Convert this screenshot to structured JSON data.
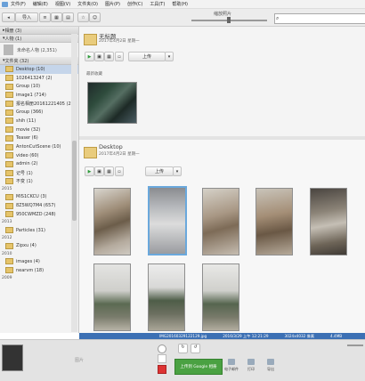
{
  "menu": [
    "文件(F)",
    "编辑(E)",
    "视图(V)",
    "文件夹(O)",
    "图片(P)",
    "创作(C)",
    "工具(T)",
    "帮助(H)"
  ],
  "toolbar": {
    "import_label": "导入",
    "zoom_label": "缩放照片"
  },
  "sidebar": {
    "sections": {
      "albums": "相册 (3)",
      "people": "人物 (1)",
      "folders": "文件夹 (32)"
    },
    "person_label": "未命名人物 (2,351)",
    "folders": [
      {
        "label": "Desktop (10)",
        "selected": true
      },
      {
        "label": "1026413247 (2)"
      },
      {
        "label": "Group (10)"
      },
      {
        "label": "image1 (714)"
      },
      {
        "label": "报名相册20161221405 (24)"
      },
      {
        "label": "Group (366)"
      },
      {
        "label": "shih (11)"
      },
      {
        "label": "movie (32)"
      },
      {
        "label": "Teaser (6)"
      },
      {
        "label": "AntonCutScene (10)"
      },
      {
        "label": "video (60)"
      },
      {
        "label": "admin (2)"
      },
      {
        "label": "记号 (1)"
      },
      {
        "label": "不变 (1)"
      }
    ],
    "year_2015": "2015",
    "folders_2015": [
      "MIS1CKCU (3)",
      "8Z5WQ7M4 (657)",
      "950CWMZD (248)"
    ],
    "year_2013": "2013",
    "folders_2013": [
      "Particles (31)"
    ],
    "year_2012": "2012",
    "folders_2012": [
      "Zipxu (4)"
    ],
    "year_2010": "2010",
    "folders_2010": [
      "images (4)",
      "nearvm (18)"
    ],
    "year_2009": "2009"
  },
  "folder1": {
    "title": "无标题",
    "date": "2017年4月2日 星期一",
    "share_label": "上传",
    "section_label": "最新收藏"
  },
  "folder2": {
    "title": "Desktop",
    "date": "2017年4月2日 星期一",
    "share_label": "上传"
  },
  "status": {
    "filename": "IMG20160329122129.jpg",
    "date": "2016/3/29 上午 12:21:29",
    "dims": "3024x4032 像素",
    "size": "4.4MB"
  },
  "tray": {
    "hint": "图片",
    "upload_label": "上传到 Google 相册",
    "actions": [
      "电子邮件",
      "打印",
      "导出"
    ]
  },
  "icons": [
    "folder-icon",
    "play-icon",
    "grid-icon",
    "star-icon",
    "person-icon",
    "search-icon",
    "rotate-left-icon",
    "rotate-right-icon",
    "email-icon",
    "print-icon",
    "export-icon"
  ]
}
